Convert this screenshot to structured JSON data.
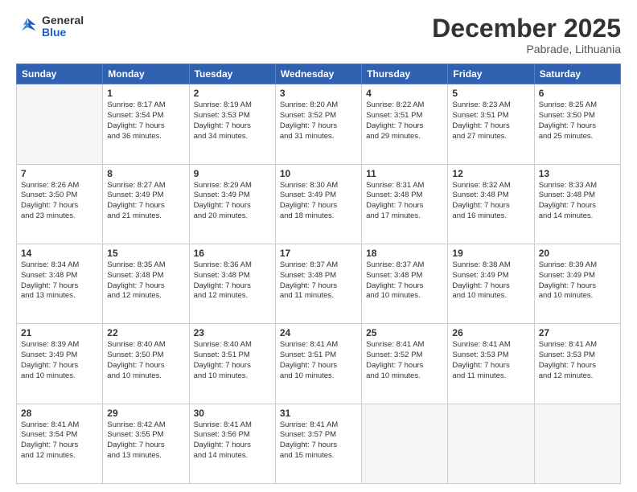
{
  "logo": {
    "general": "General",
    "blue": "Blue"
  },
  "header": {
    "month": "December 2025",
    "location": "Pabrade, Lithuania"
  },
  "weekdays": [
    "Sunday",
    "Monday",
    "Tuesday",
    "Wednesday",
    "Thursday",
    "Friday",
    "Saturday"
  ],
  "weeks": [
    [
      {
        "day": "",
        "sunrise": "",
        "sunset": "",
        "daylight": ""
      },
      {
        "day": "1",
        "sunrise": "Sunrise: 8:17 AM",
        "sunset": "Sunset: 3:54 PM",
        "daylight": "Daylight: 7 hours and 36 minutes."
      },
      {
        "day": "2",
        "sunrise": "Sunrise: 8:19 AM",
        "sunset": "Sunset: 3:53 PM",
        "daylight": "Daylight: 7 hours and 34 minutes."
      },
      {
        "day": "3",
        "sunrise": "Sunrise: 8:20 AM",
        "sunset": "Sunset: 3:52 PM",
        "daylight": "Daylight: 7 hours and 31 minutes."
      },
      {
        "day": "4",
        "sunrise": "Sunrise: 8:22 AM",
        "sunset": "Sunset: 3:51 PM",
        "daylight": "Daylight: 7 hours and 29 minutes."
      },
      {
        "day": "5",
        "sunrise": "Sunrise: 8:23 AM",
        "sunset": "Sunset: 3:51 PM",
        "daylight": "Daylight: 7 hours and 27 minutes."
      },
      {
        "day": "6",
        "sunrise": "Sunrise: 8:25 AM",
        "sunset": "Sunset: 3:50 PM",
        "daylight": "Daylight: 7 hours and 25 minutes."
      }
    ],
    [
      {
        "day": "7",
        "sunrise": "Sunrise: 8:26 AM",
        "sunset": "Sunset: 3:50 PM",
        "daylight": "Daylight: 7 hours and 23 minutes."
      },
      {
        "day": "8",
        "sunrise": "Sunrise: 8:27 AM",
        "sunset": "Sunset: 3:49 PM",
        "daylight": "Daylight: 7 hours and 21 minutes."
      },
      {
        "day": "9",
        "sunrise": "Sunrise: 8:29 AM",
        "sunset": "Sunset: 3:49 PM",
        "daylight": "Daylight: 7 hours and 20 minutes."
      },
      {
        "day": "10",
        "sunrise": "Sunrise: 8:30 AM",
        "sunset": "Sunset: 3:49 PM",
        "daylight": "Daylight: 7 hours and 18 minutes."
      },
      {
        "day": "11",
        "sunrise": "Sunrise: 8:31 AM",
        "sunset": "Sunset: 3:48 PM",
        "daylight": "Daylight: 7 hours and 17 minutes."
      },
      {
        "day": "12",
        "sunrise": "Sunrise: 8:32 AM",
        "sunset": "Sunset: 3:48 PM",
        "daylight": "Daylight: 7 hours and 16 minutes."
      },
      {
        "day": "13",
        "sunrise": "Sunrise: 8:33 AM",
        "sunset": "Sunset: 3:48 PM",
        "daylight": "Daylight: 7 hours and 14 minutes."
      }
    ],
    [
      {
        "day": "14",
        "sunrise": "Sunrise: 8:34 AM",
        "sunset": "Sunset: 3:48 PM",
        "daylight": "Daylight: 7 hours and 13 minutes."
      },
      {
        "day": "15",
        "sunrise": "Sunrise: 8:35 AM",
        "sunset": "Sunset: 3:48 PM",
        "daylight": "Daylight: 7 hours and 12 minutes."
      },
      {
        "day": "16",
        "sunrise": "Sunrise: 8:36 AM",
        "sunset": "Sunset: 3:48 PM",
        "daylight": "Daylight: 7 hours and 12 minutes."
      },
      {
        "day": "17",
        "sunrise": "Sunrise: 8:37 AM",
        "sunset": "Sunset: 3:48 PM",
        "daylight": "Daylight: 7 hours and 11 minutes."
      },
      {
        "day": "18",
        "sunrise": "Sunrise: 8:37 AM",
        "sunset": "Sunset: 3:48 PM",
        "daylight": "Daylight: 7 hours and 10 minutes."
      },
      {
        "day": "19",
        "sunrise": "Sunrise: 8:38 AM",
        "sunset": "Sunset: 3:49 PM",
        "daylight": "Daylight: 7 hours and 10 minutes."
      },
      {
        "day": "20",
        "sunrise": "Sunrise: 8:39 AM",
        "sunset": "Sunset: 3:49 PM",
        "daylight": "Daylight: 7 hours and 10 minutes."
      }
    ],
    [
      {
        "day": "21",
        "sunrise": "Sunrise: 8:39 AM",
        "sunset": "Sunset: 3:49 PM",
        "daylight": "Daylight: 7 hours and 10 minutes."
      },
      {
        "day": "22",
        "sunrise": "Sunrise: 8:40 AM",
        "sunset": "Sunset: 3:50 PM",
        "daylight": "Daylight: 7 hours and 10 minutes."
      },
      {
        "day": "23",
        "sunrise": "Sunrise: 8:40 AM",
        "sunset": "Sunset: 3:51 PM",
        "daylight": "Daylight: 7 hours and 10 minutes."
      },
      {
        "day": "24",
        "sunrise": "Sunrise: 8:41 AM",
        "sunset": "Sunset: 3:51 PM",
        "daylight": "Daylight: 7 hours and 10 minutes."
      },
      {
        "day": "25",
        "sunrise": "Sunrise: 8:41 AM",
        "sunset": "Sunset: 3:52 PM",
        "daylight": "Daylight: 7 hours and 10 minutes."
      },
      {
        "day": "26",
        "sunrise": "Sunrise: 8:41 AM",
        "sunset": "Sunset: 3:53 PM",
        "daylight": "Daylight: 7 hours and 11 minutes."
      },
      {
        "day": "27",
        "sunrise": "Sunrise: 8:41 AM",
        "sunset": "Sunset: 3:53 PM",
        "daylight": "Daylight: 7 hours and 12 minutes."
      }
    ],
    [
      {
        "day": "28",
        "sunrise": "Sunrise: 8:41 AM",
        "sunset": "Sunset: 3:54 PM",
        "daylight": "Daylight: 7 hours and 12 minutes."
      },
      {
        "day": "29",
        "sunrise": "Sunrise: 8:42 AM",
        "sunset": "Sunset: 3:55 PM",
        "daylight": "Daylight: 7 hours and 13 minutes."
      },
      {
        "day": "30",
        "sunrise": "Sunrise: 8:41 AM",
        "sunset": "Sunset: 3:56 PM",
        "daylight": "Daylight: 7 hours and 14 minutes."
      },
      {
        "day": "31",
        "sunrise": "Sunrise: 8:41 AM",
        "sunset": "Sunset: 3:57 PM",
        "daylight": "Daylight: 7 hours and 15 minutes."
      },
      {
        "day": "",
        "sunrise": "",
        "sunset": "",
        "daylight": ""
      },
      {
        "day": "",
        "sunrise": "",
        "sunset": "",
        "daylight": ""
      },
      {
        "day": "",
        "sunrise": "",
        "sunset": "",
        "daylight": ""
      }
    ]
  ]
}
